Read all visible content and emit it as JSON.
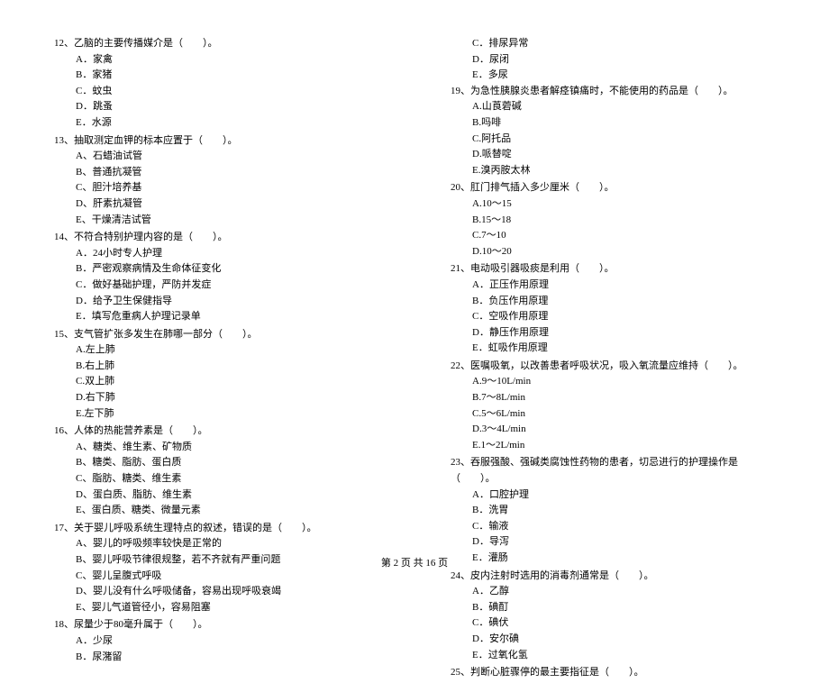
{
  "left": [
    {
      "num": "12、",
      "text": "乙脑的主要传播媒介是（　　）。",
      "opts": [
        "A．家禽",
        "B．家猪",
        "C．蚊虫",
        "D．跳蚤",
        "E．水源"
      ]
    },
    {
      "num": "13、",
      "text": "抽取测定血钾的标本应置于（　　）。",
      "opts": [
        "A、石蜡油试管",
        "B、普通抗凝管",
        "C、胆汁培养基",
        "D、肝素抗凝管",
        "E、干燥清洁试管"
      ]
    },
    {
      "num": "14、",
      "text": "不符合特别护理内容的是（　　）。",
      "opts": [
        "A．24小时专人护理",
        "B．严密观察病情及生命体征变化",
        "C．做好基础护理，严防并发症",
        "D．给予卫生保健指导",
        "E．填写危重病人护理记录单"
      ]
    },
    {
      "num": "15、",
      "text": "支气管扩张多发生在肺哪一部分（　　）。",
      "opts": [
        "A.左上肺",
        "B.右上肺",
        "C.双上肺",
        "D.右下肺",
        "E.左下肺"
      ]
    },
    {
      "num": "16、",
      "text": "人体的热能营养素是（　　）。",
      "opts": [
        "A、糖类、维生素、矿物质",
        "B、糖类、脂肪、蛋白质",
        "C、脂肪、糖类、维生素",
        "D、蛋白质、脂肪、维生素",
        "E、蛋白质、糖类、微量元素"
      ]
    },
    {
      "num": "17、",
      "text": "关于婴儿呼吸系统生理特点的叙述，错误的是（　　）。",
      "opts": [
        "A、婴儿的呼吸频率较快是正常的",
        "B、婴儿呼吸节律很规整，若不齐就有严重问题",
        "C、婴儿呈腹式呼吸",
        "D、婴儿没有什么呼吸储备，容易出现呼吸衰竭",
        "E、婴儿气道管径小，容易阻塞"
      ]
    },
    {
      "num": "18、",
      "text": "尿量少于80毫升属于（　　）。",
      "opts": [
        "A．少尿",
        "B．尿潴留"
      ]
    }
  ],
  "right_pre": [
    "C．排尿异常",
    "D．尿闭",
    "E．多尿"
  ],
  "right": [
    {
      "num": "19、",
      "text": "为急性胰腺炎患者解痉镇痛时，不能使用的药品是（　　）。",
      "opts": [
        "A.山莨菪碱",
        "B.吗啡",
        "C.阿托品",
        "D.哌替啶",
        "E.溴丙胺太林"
      ]
    },
    {
      "num": "20、",
      "text": "肛门排气插入多少厘米（　　）。",
      "opts": [
        "A.10～15",
        "B.15～18",
        "C.7～10",
        "D.10～20"
      ]
    },
    {
      "num": "21、",
      "text": "电动吸引器吸痰是利用（　　）。",
      "opts": [
        "A．正压作用原理",
        "B．负压作用原理",
        "C．空吸作用原理",
        "D．静压作用原理",
        "E．虹吸作用原理"
      ]
    },
    {
      "num": "22、",
      "text": "医嘱吸氧，以改善患者呼吸状况，吸入氧流量应维持（　　）。",
      "opts": [
        "A.9～10L/min",
        "B.7～8L/min",
        "C.5～6L/min",
        "D.3～4L/min",
        "E.1～2L/min"
      ]
    },
    {
      "num": "23、",
      "text": "吞服强酸、强碱类腐蚀性药物的患者，切忌进行的护理操作是（　　）。",
      "opts": [
        "A．口腔护理",
        "B．洗胃",
        "C．输液",
        "D．导泻",
        "E．灌肠"
      ]
    },
    {
      "num": "24、",
      "text": "皮内注射时选用的消毒剂通常是（　　）。",
      "opts": [
        "A．乙醇",
        "B．碘酊",
        "C．碘伏",
        "D．安尔碘",
        "E．过氧化氢"
      ]
    },
    {
      "num": "25、",
      "text": "判断心脏骤停的最主要指征是（　　）。",
      "opts": []
    }
  ],
  "footer": "第 2 页 共 16 页"
}
